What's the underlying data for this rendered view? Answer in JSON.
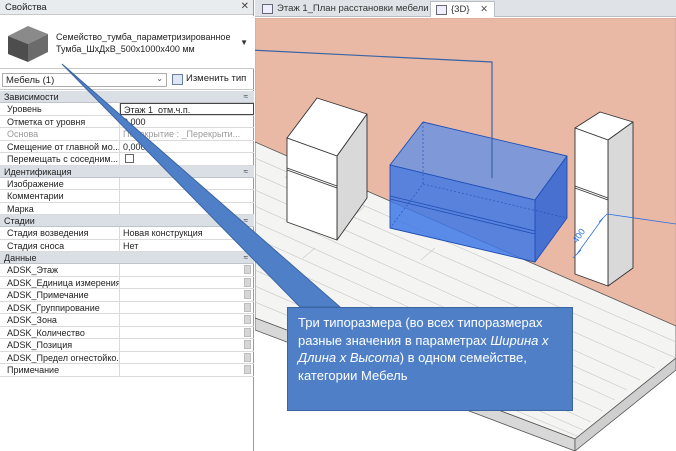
{
  "properties": {
    "title": "Свойства",
    "close_glyph": "✕",
    "type_name_line1": "Семейство_тумба_параметризированное",
    "type_name_line2": "Тумба_ШхДхВ_500x1000x400 мм",
    "category_filter": "Мебель (1)",
    "edit_type_label": "Изменить тип",
    "sections": [
      {
        "name": "Зависимости",
        "rows": [
          {
            "label": "Уровень",
            "value": "Этаж 1_отм.ч.п."
          },
          {
            "label": "Отметка от уровня",
            "value": "0,000"
          },
          {
            "label": "Основа",
            "value": "Перекрытие : _Перекрыти..."
          },
          {
            "label": "Смещение от главной мо...",
            "value": "0,000"
          },
          {
            "label": "Перемещать с соседним...",
            "value": ""
          }
        ]
      },
      {
        "name": "Идентификация",
        "rows": [
          {
            "label": "Изображение",
            "value": ""
          },
          {
            "label": "Комментарии",
            "value": ""
          },
          {
            "label": "Марка",
            "value": ""
          }
        ]
      },
      {
        "name": "Стадии",
        "rows": [
          {
            "label": "Стадия возведения",
            "value": "Новая конструкция"
          },
          {
            "label": "Стадия сноса",
            "value": "Нет"
          }
        ]
      },
      {
        "name": "Данные",
        "rows": [
          {
            "label": "ADSK_Этаж",
            "value": ""
          },
          {
            "label": "ADSK_Единица измерения",
            "value": ""
          },
          {
            "label": "ADSK_Примечание",
            "value": ""
          },
          {
            "label": "ADSK_Группирование",
            "value": ""
          },
          {
            "label": "ADSK_Зона",
            "value": ""
          },
          {
            "label": "ADSK_Количество",
            "value": ""
          },
          {
            "label": "ADSK_Позиция",
            "value": ""
          },
          {
            "label": "ADSK_Предел огнестойко...",
            "value": ""
          },
          {
            "label": "Примечание",
            "value": ""
          }
        ]
      }
    ]
  },
  "tabs": [
    {
      "label": "Этаж 1_План расстановки мебели",
      "close": "✕"
    },
    {
      "label": "{3D}",
      "close": "✕"
    }
  ],
  "viewport": {
    "dimension_label": "400"
  },
  "callout": {
    "text_part1": "Три типоразмера (во всех типоразмерах разные значения в параметрах ",
    "text_italic": "Ширина х Длина х Высота",
    "text_part2": ") в одном семействе, категории Мебель"
  },
  "colors": {
    "accent": "#4f80c7",
    "wall": "#e9b9a6",
    "selection": "#2f6fe0"
  }
}
